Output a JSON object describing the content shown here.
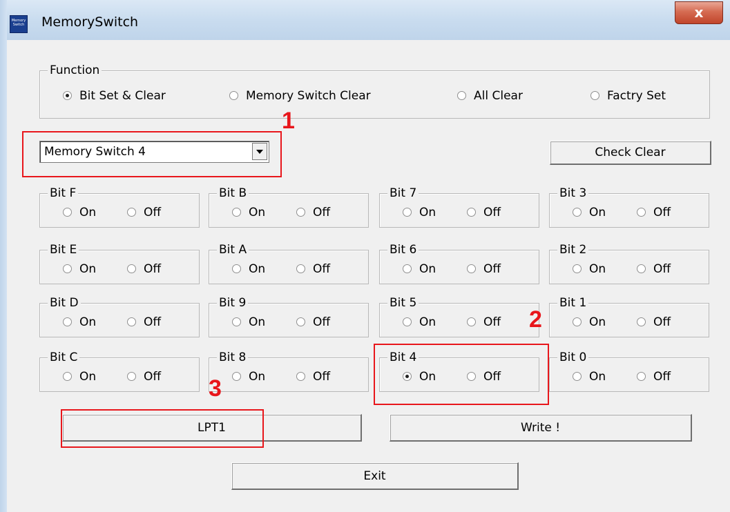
{
  "window": {
    "title": "MemorySwitch",
    "app_icon_text": "Memory Switch",
    "close_label": "x"
  },
  "function_group": {
    "legend": "Function",
    "options": [
      {
        "label": "Bit Set & Clear",
        "checked": true
      },
      {
        "label": "Memory Switch Clear",
        "checked": false
      },
      {
        "label": "All Clear",
        "checked": false
      },
      {
        "label": "Factry Set",
        "checked": false
      }
    ]
  },
  "memory_switch_select": {
    "value": "Memory Switch 4"
  },
  "check_clear_label": "Check Clear",
  "bits": [
    {
      "name": "Bit F",
      "on": false,
      "off": false
    },
    {
      "name": "Bit B",
      "on": false,
      "off": false
    },
    {
      "name": "Bit 7",
      "on": false,
      "off": false
    },
    {
      "name": "Bit 3",
      "on": false,
      "off": false
    },
    {
      "name": "Bit E",
      "on": false,
      "off": false
    },
    {
      "name": "Bit A",
      "on": false,
      "off": false
    },
    {
      "name": "Bit 6",
      "on": false,
      "off": false
    },
    {
      "name": "Bit 2",
      "on": false,
      "off": false
    },
    {
      "name": "Bit D",
      "on": false,
      "off": false
    },
    {
      "name": "Bit 9",
      "on": false,
      "off": false
    },
    {
      "name": "Bit 5",
      "on": false,
      "off": false
    },
    {
      "name": "Bit 1",
      "on": false,
      "off": false
    },
    {
      "name": "Bit C",
      "on": false,
      "off": false
    },
    {
      "name": "Bit 8",
      "on": false,
      "off": false
    },
    {
      "name": "Bit 4",
      "on": true,
      "off": false
    },
    {
      "name": "Bit 0",
      "on": false,
      "off": false
    }
  ],
  "radio_on_label": "On",
  "radio_off_label": "Off",
  "port_button_label": "LPT1",
  "write_button_label": "Write !",
  "exit_button_label": "Exit",
  "annotations": {
    "marker1": "1",
    "marker2": "2",
    "marker3": "3",
    "color": "#e8161b"
  }
}
